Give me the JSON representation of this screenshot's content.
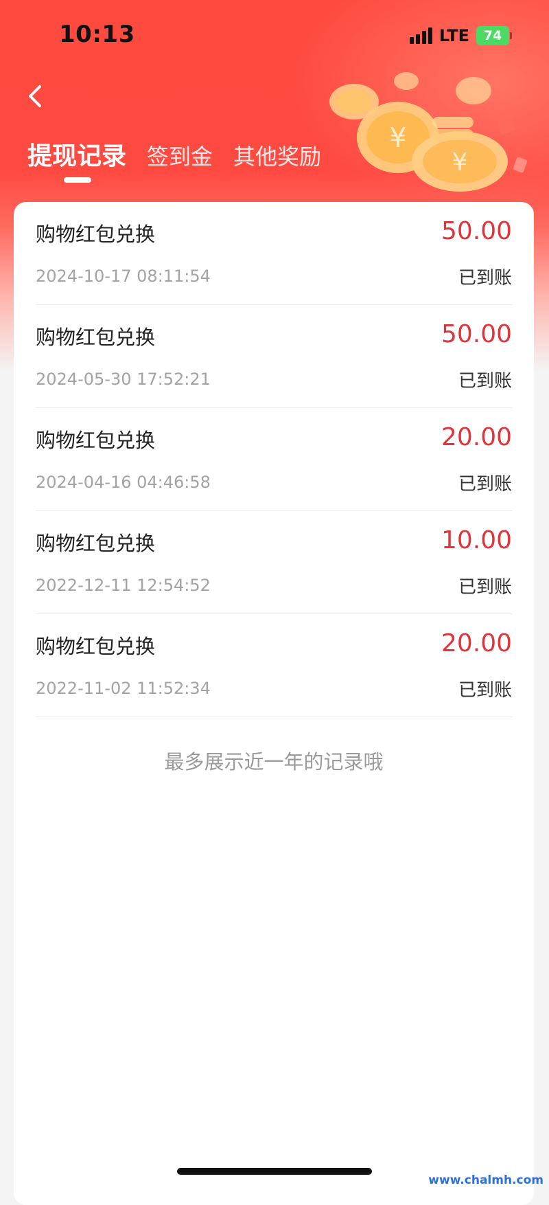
{
  "status_bar": {
    "time": "10:13",
    "network": "LTE",
    "battery": "74"
  },
  "nav": {
    "back_icon": "chevron-left-icon"
  },
  "tabs": [
    {
      "label": "提现记录",
      "active": true
    },
    {
      "label": "签到金",
      "active": false
    },
    {
      "label": "其他奖励",
      "active": false
    }
  ],
  "records": [
    {
      "title": "购物红包兑换",
      "amount": "50.00",
      "date": "2024-10-17 08:11:54",
      "status": "已到账"
    },
    {
      "title": "购物红包兑换",
      "amount": "50.00",
      "date": "2024-05-30 17:52:21",
      "status": "已到账"
    },
    {
      "title": "购物红包兑换",
      "amount": "20.00",
      "date": "2024-04-16 04:46:58",
      "status": "已到账"
    },
    {
      "title": "购物红包兑换",
      "amount": "10.00",
      "date": "2022-12-11 12:54:52",
      "status": "已到账"
    },
    {
      "title": "购物红包兑换",
      "amount": "20.00",
      "date": "2022-11-02 11:52:34",
      "status": "已到账"
    }
  ],
  "footer_note": "最多展示近一年的记录哦",
  "watermark": "www.chalmh.com",
  "colors": {
    "header_red": "#ff4a3f",
    "amount_red": "#e0353a",
    "battery_green": "#4cd964"
  }
}
